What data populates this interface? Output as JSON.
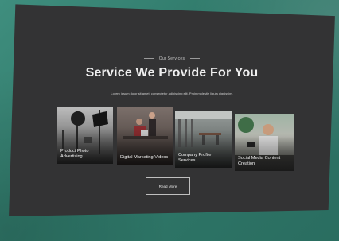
{
  "services": {
    "eyebrow": "Our Services",
    "title": "Service We Provide For You",
    "subtitle": "Lorem ipsum dolor sit amet, consectetur adipiscing elit. Proin molestie ligula dignissim.",
    "cards": [
      {
        "label": "Product Photo Advertising",
        "icon": "camera-studio-photo"
      },
      {
        "label": "Digital Marketing Videos",
        "icon": "people-at-desk-photo"
      },
      {
        "label": "Company Profile Services",
        "icon": "office-interior-photo"
      },
      {
        "label": "Social Media Content Creation",
        "icon": "person-with-phone-photo"
      }
    ],
    "read_more": "Read More"
  },
  "colors": {
    "background": "#2f7869",
    "panel": "#333334",
    "text": "#f0f0f0"
  }
}
